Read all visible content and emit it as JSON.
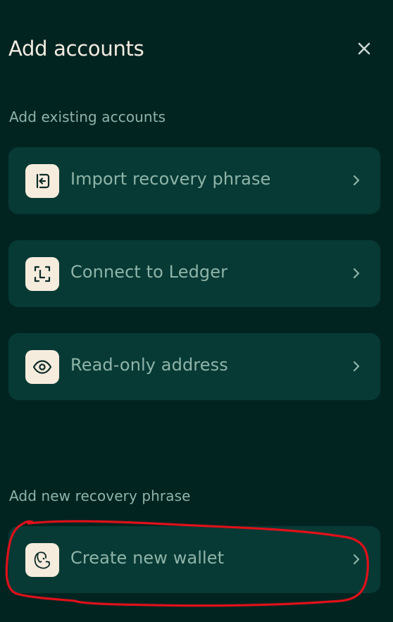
{
  "header": {
    "title": "Add accounts",
    "close_icon": "close-icon"
  },
  "sections": {
    "existing_label": "Add existing accounts",
    "new_label": "Add new recovery phrase"
  },
  "options": [
    {
      "label": "Import recovery phrase",
      "icon": "import-icon"
    },
    {
      "label": "Connect to Ledger",
      "icon": "ledger-icon"
    },
    {
      "label": "Read-only address",
      "icon": "eye-icon"
    },
    {
      "label": "Create new wallet",
      "icon": "dog-icon"
    }
  ],
  "colors": {
    "background": "#022421",
    "card": "#073a35",
    "icon_tile": "#f6ecdd",
    "text_muted": "#8fb4a8",
    "title": "#f3ece1",
    "annotation": "#e0101a"
  }
}
